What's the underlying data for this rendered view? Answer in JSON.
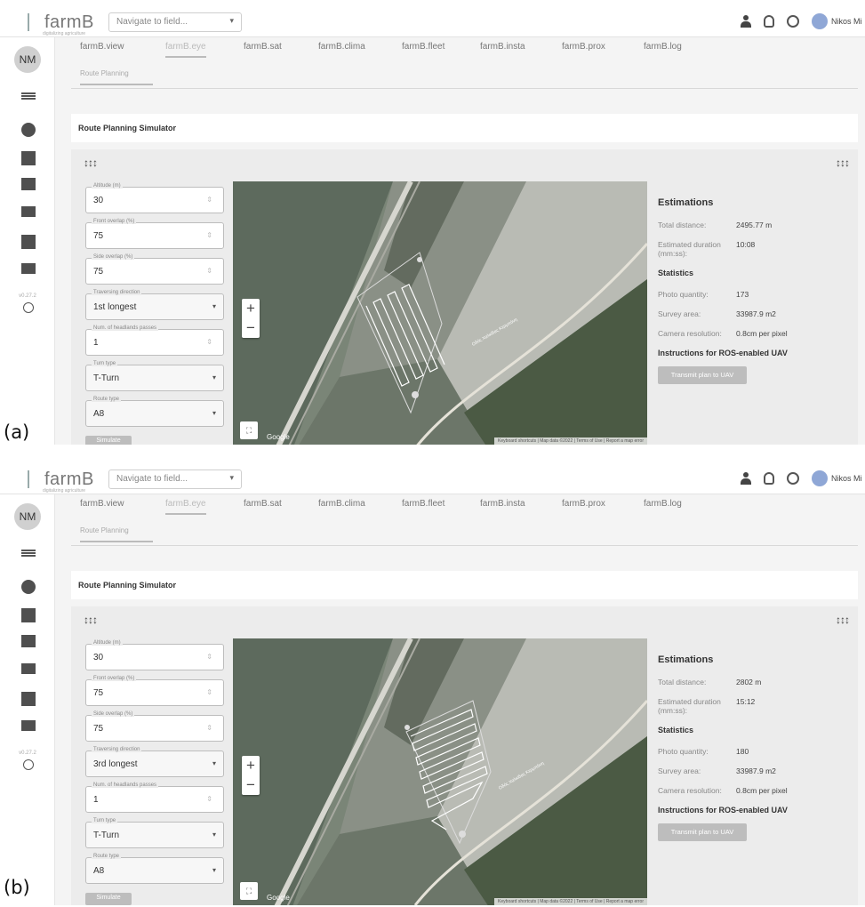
{
  "app": {
    "brand": "farmB",
    "brand_sub": "digitalizing agriculture",
    "nav_placeholder": "Navigate to field..."
  },
  "user": {
    "initials": "NM",
    "name": "Nikos Mi"
  },
  "sidebar": {
    "version": "v0.27.2"
  },
  "tabs": [
    "farmB.view",
    "farmB.eye",
    "farmB.sat",
    "farmB.clima",
    "farmB.fleet",
    "farmB.insta",
    "farmB.prox",
    "farmB.log"
  ],
  "active_tab": "farmB.eye",
  "subtab": "Route Planning",
  "card_title": "Route Planning Simulator",
  "form_labels": {
    "altitude": "Altitude (m)",
    "front_overlap": "Front overlap (%)",
    "side_overlap": "Side overlap (%)",
    "traversing_direction": "Traversing direction",
    "num_headlands": "Num. of headlands passes",
    "turn_type": "Turn type",
    "route_type": "Route type",
    "simulate": "Simulate"
  },
  "map": {
    "google": "Google",
    "attribution": "Keyboard shortcuts | Map data ©2022 | Terms of Use | Report a map error",
    "road_label": "Οδός Χαλκίδας Κερμπάνη"
  },
  "stats_labels": {
    "estimations": "Estimations",
    "total_distance": "Total distance:",
    "duration": "Estimated duration (mm:ss):",
    "statistics": "Statistics",
    "photo_quantity": "Photo quantity:",
    "survey_area": "Survey area:",
    "camera_resolution": "Camera resolution:",
    "ros": "Instructions for ROS-enabled UAV",
    "transmit": "Transmit plan to UAV"
  },
  "panel_a": {
    "caption": "(a)",
    "altitude": "30",
    "front_overlap": "75",
    "side_overlap": "75",
    "traversing_direction": "1st longest",
    "num_headlands": "1",
    "turn_type": "T-Turn",
    "route_type": "A8",
    "total_distance": "2495.77 m",
    "duration": "10:08",
    "photo_quantity": "173",
    "survey_area": "33987.9 m2",
    "camera_resolution": "0.8cm per pixel"
  },
  "panel_b": {
    "caption": "(b)",
    "altitude": "30",
    "front_overlap": "75",
    "side_overlap": "75",
    "traversing_direction": "3rd longest",
    "num_headlands": "1",
    "turn_type": "T-Turn",
    "route_type": "A8",
    "total_distance": "2802 m",
    "duration": "15:12",
    "photo_quantity": "180",
    "survey_area": "33987.9 m2",
    "camera_resolution": "0.8cm per pixel"
  },
  "colors": {
    "accent_grey": "#bdbdbd",
    "map_field": "#6f7a6d"
  }
}
